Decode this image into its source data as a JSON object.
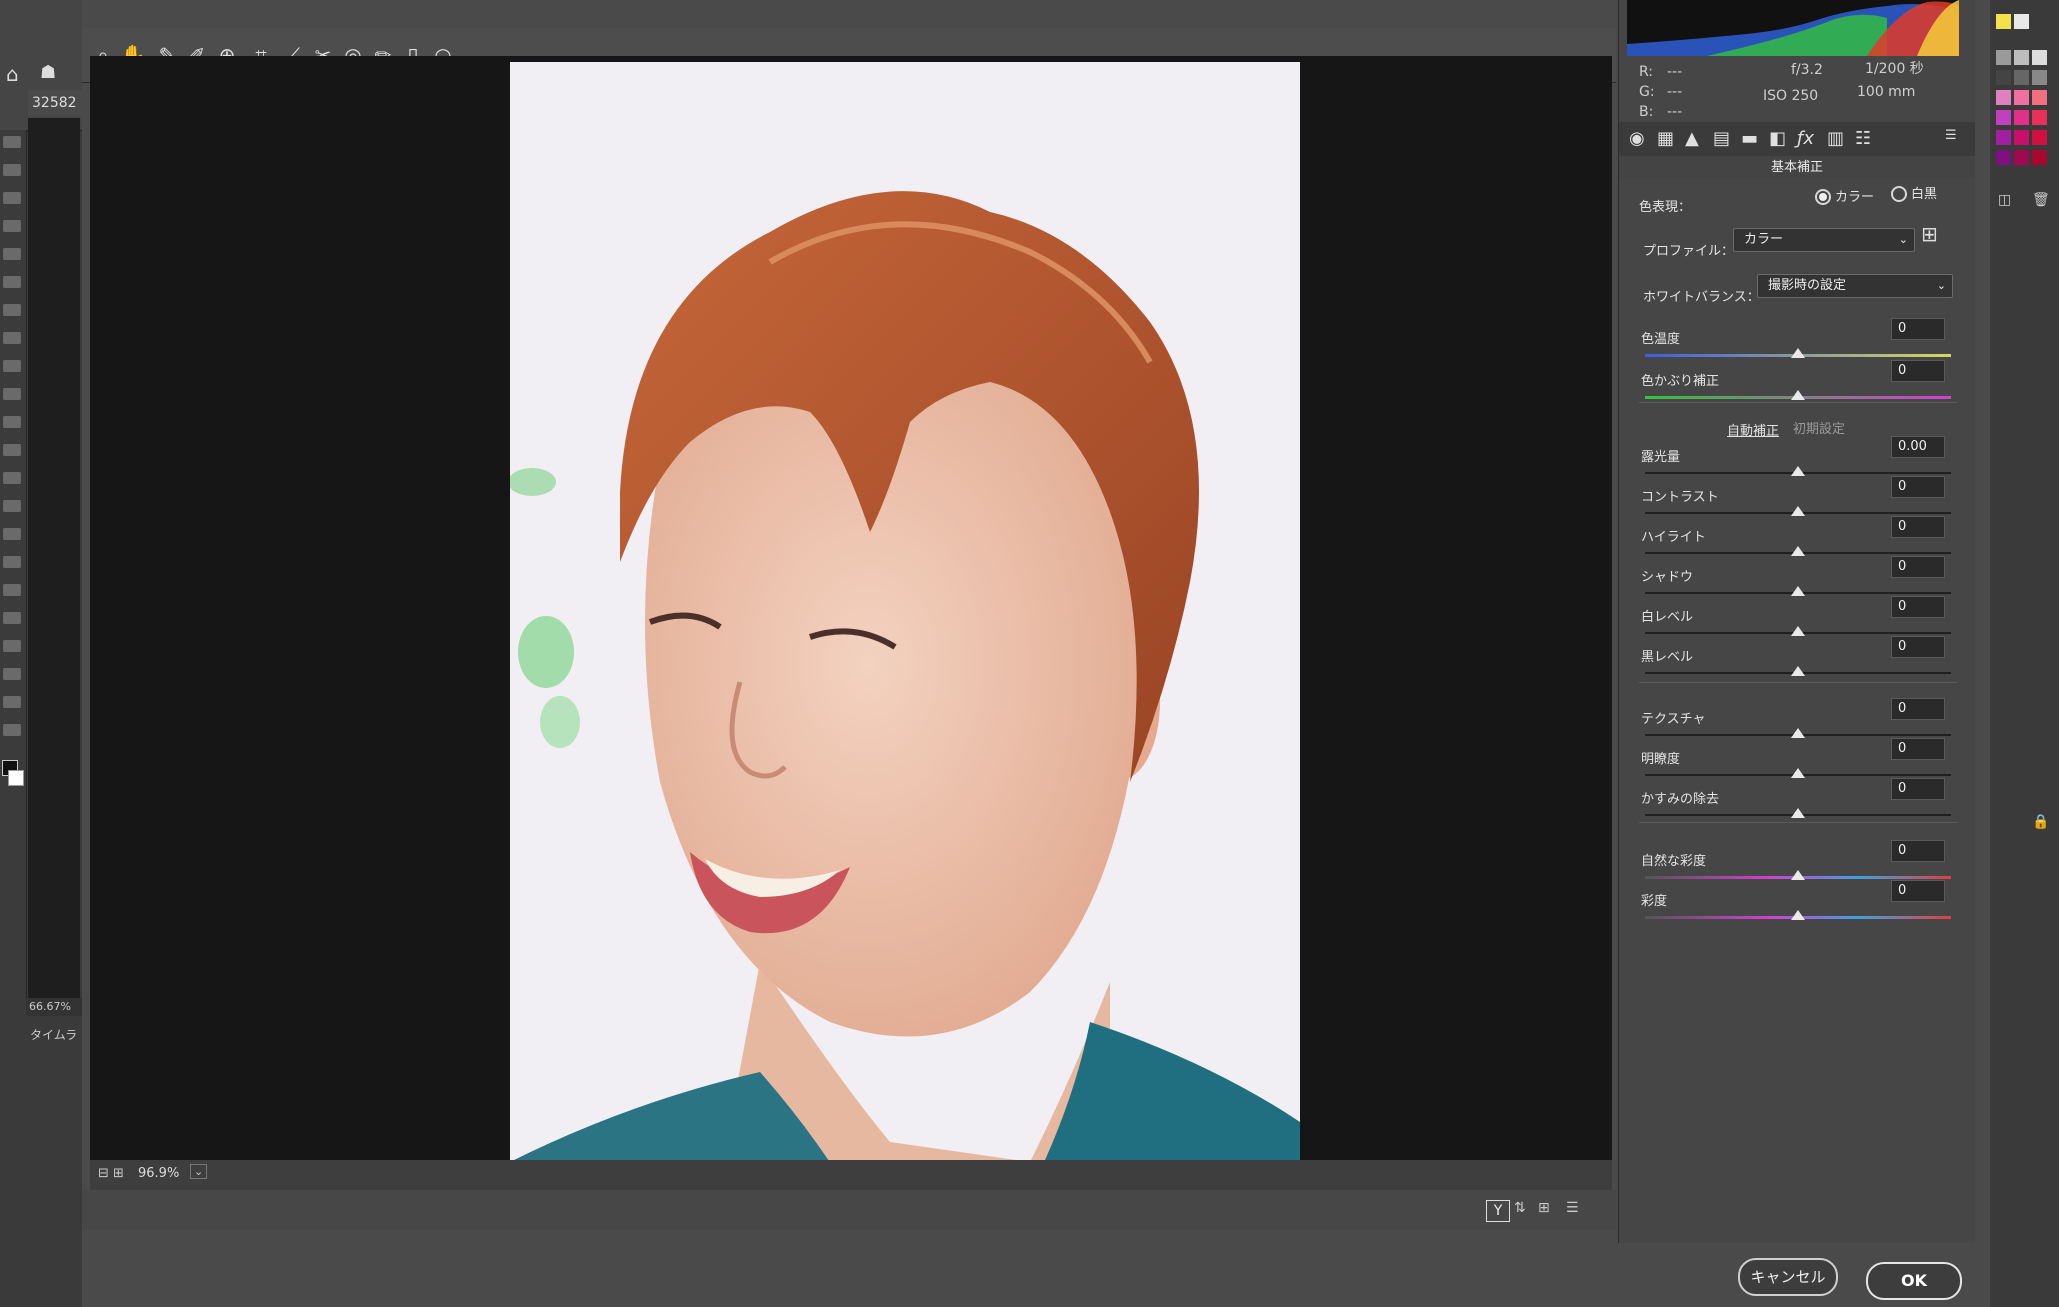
{
  "ps_window": {
    "doc_tab": "32582",
    "zoom": "66.67%",
    "timeline_label": "タイムライ"
  },
  "camera_raw": {
    "zoom_level": "96.9%",
    "info": {
      "r_label": "R:",
      "r_value": "---",
      "g_label": "G:",
      "g_value": "---",
      "b_label": "B:",
      "b_value": "---",
      "aperture": "f/3.2",
      "shutter": "1/200 秒",
      "iso": "ISO 250",
      "focal": "100 mm"
    },
    "panel_title": "基本補正",
    "treatment": {
      "label": "色表現：",
      "color_option": "カラー",
      "bw_option": "白黒",
      "selected": "カラー"
    },
    "profile": {
      "label": "プロファイル：",
      "value": "カラー"
    },
    "white_balance": {
      "label": "ホワイトバランス：",
      "value": "撮影時の設定"
    },
    "auto_label": "自動補正",
    "default_label": "初期設定",
    "sliders": [
      {
        "label": "色温度",
        "value": "0",
        "level": 0.5
      },
      {
        "label": "色かぶり補正",
        "value": "0",
        "level": 0.5
      },
      {
        "label": "露光量",
        "value": "0.00",
        "level": 0.5
      },
      {
        "label": "コントラスト",
        "value": "0",
        "level": 0.5
      },
      {
        "label": "ハイライト",
        "value": "0",
        "level": 0.5
      },
      {
        "label": "シャドウ",
        "value": "0",
        "level": 0.5
      },
      {
        "label": "白レベル",
        "value": "0",
        "level": 0.5
      },
      {
        "label": "黒レベル",
        "value": "0",
        "level": 0.5
      },
      {
        "label": "テクスチャ",
        "value": "0",
        "level": 0.5
      },
      {
        "label": "明瞭度",
        "value": "0",
        "level": 0.5
      },
      {
        "label": "かすみの除去",
        "value": "0",
        "level": 0.5
      },
      {
        "label": "自然な彩度",
        "value": "0",
        "level": 0.5
      },
      {
        "label": "彩度",
        "value": "0",
        "level": 0.5
      }
    ],
    "buttons": {
      "cancel": "キャンセル",
      "ok": "OK"
    }
  },
  "colors": {
    "dialog_bg": "#4a4a4a",
    "canvas_bg": "#161616",
    "panel_bg": "#464646",
    "hair": "#b5562c",
    "shirt": "#1f6f80",
    "photo_bg": "#f0eef2"
  }
}
